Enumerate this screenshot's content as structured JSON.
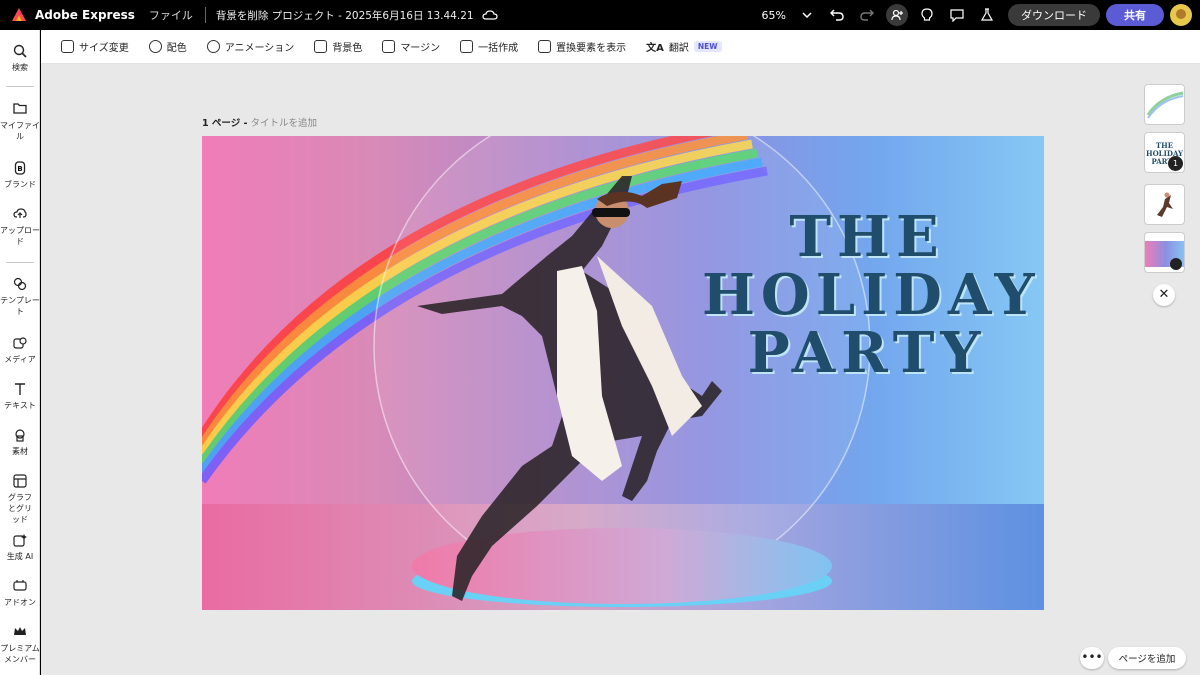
{
  "app": {
    "name": "Adobe Express",
    "file_menu": "ファイル",
    "doc_title": "背景を削除 プロジェクト - 2025年6月16日 13.44.21"
  },
  "topbar": {
    "zoom": "65%",
    "download_label": "ダウンロード",
    "share_label": "共有"
  },
  "sidebar": {
    "items": [
      {
        "label": "検索",
        "icon": "search-icon"
      },
      {
        "label": "マイファイル",
        "icon": "folder-icon"
      },
      {
        "label": "ブランド",
        "icon": "brand-icon"
      },
      {
        "label": "アップロード",
        "icon": "upload-icon"
      },
      {
        "label": "テンプレート",
        "icon": "template-icon"
      },
      {
        "label": "メディア",
        "icon": "media-icon"
      },
      {
        "label": "テキスト",
        "icon": "text-icon"
      },
      {
        "label": "素材",
        "icon": "elements-icon"
      },
      {
        "label": "グラフとグリッド",
        "icon": "grid-icon"
      },
      {
        "label": "生成 AI",
        "icon": "ai-icon"
      },
      {
        "label": "アドオン",
        "icon": "addon-icon"
      },
      {
        "label": "プレミアムメンバー",
        "icon": "crown-icon"
      }
    ]
  },
  "toolbar": {
    "resize": "サイズ変更",
    "color": "配色",
    "animation": "アニメーション",
    "background": "背景色",
    "margin": "マージン",
    "bulk_create": "一括作成",
    "show_replaceable": "置換要素を表示",
    "translate": "翻訳",
    "new_badge": "NEW"
  },
  "page": {
    "number_label": "1 ページ -",
    "add_title": "タイトルを追加"
  },
  "canvas": {
    "headline_line1": "THE",
    "headline_line2": "HOLIDAY",
    "headline_line3": "PARTY",
    "headline_color": "#1f4d6b"
  },
  "rail": {
    "badge_count": "1",
    "thumb2_line1": "THE",
    "thumb2_line2": "HOLIDAY",
    "thumb2_line3": "PARTY"
  },
  "footer": {
    "more": "•••",
    "add_page": "ページを追加"
  }
}
